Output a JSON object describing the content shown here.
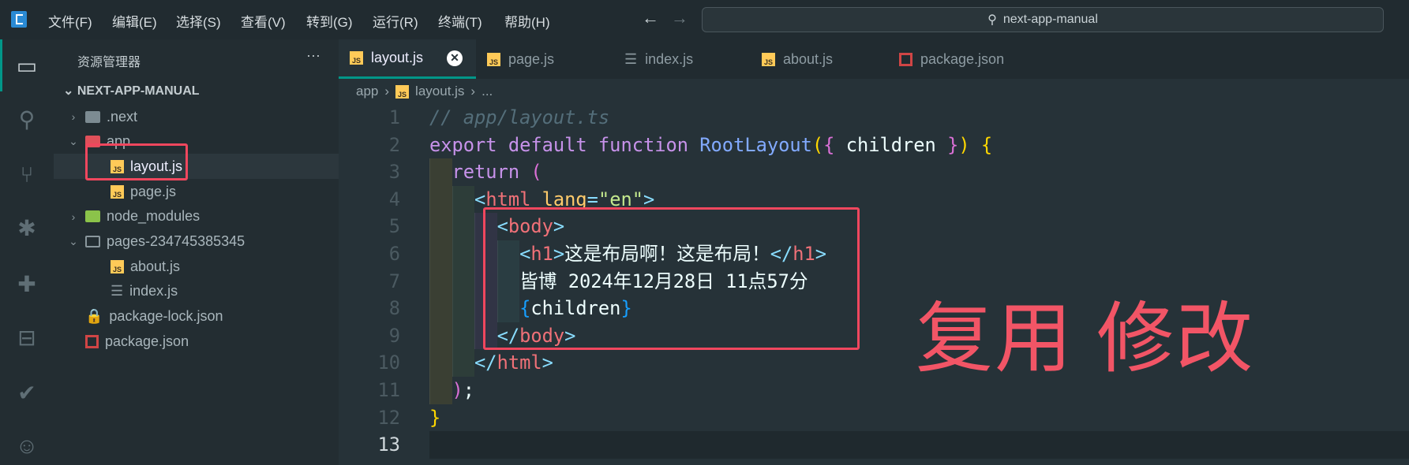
{
  "menu": [
    "文件(F)",
    "编辑(E)",
    "选择(S)",
    "查看(V)",
    "转到(G)",
    "运行(R)",
    "终端(T)",
    "帮助(H)"
  ],
  "search": {
    "text": "next-app-manual"
  },
  "sidebar": {
    "title": "资源管理器",
    "more": "···",
    "root": "NEXT-APP-MANUAL",
    "items": [
      {
        "label": ".next",
        "level": 0,
        "type": "folder-next",
        "chevron": "›"
      },
      {
        "label": "app",
        "level": 0,
        "type": "folder-app",
        "chevron": "⌄"
      },
      {
        "label": "layout.js",
        "level": 1,
        "type": "js",
        "selected": true
      },
      {
        "label": "page.js",
        "level": 1,
        "type": "js"
      },
      {
        "label": "node_modules",
        "level": 0,
        "type": "folder-node",
        "chevron": "›"
      },
      {
        "label": "pages-234745385345",
        "level": 0,
        "type": "folder",
        "chevron": "⌄"
      },
      {
        "label": "about.js",
        "level": 1,
        "type": "js"
      },
      {
        "label": "index.js",
        "level": 1,
        "type": "list"
      },
      {
        "label": "package-lock.json",
        "level": 0,
        "type": "lock"
      },
      {
        "label": "package.json",
        "level": 0,
        "type": "npm"
      }
    ]
  },
  "tabs": [
    {
      "label": "layout.js",
      "type": "js",
      "active": true
    },
    {
      "label": "page.js",
      "type": "js"
    },
    {
      "label": "index.js",
      "type": "list"
    },
    {
      "label": "about.js",
      "type": "js"
    },
    {
      "label": "package.json",
      "type": "npm"
    }
  ],
  "breadcrumb": [
    "app",
    "layout.js",
    "..."
  ],
  "code": [
    [
      [
        "// app/layout.ts",
        "comment"
      ]
    ],
    [
      [
        "export ",
        "kw"
      ],
      [
        "default ",
        "kw"
      ],
      [
        "function ",
        "kw"
      ],
      [
        "RootLayout",
        "fn"
      ],
      [
        "(",
        "by"
      ],
      [
        "{ ",
        "bp"
      ],
      [
        "children ",
        "txt"
      ],
      [
        "}",
        "bp"
      ],
      [
        ")",
        "by"
      ],
      [
        " {",
        "by"
      ]
    ],
    [
      [
        "  return ",
        "kw"
      ],
      [
        "(",
        "bp"
      ]
    ],
    [
      [
        "    <",
        "pu"
      ],
      [
        "html ",
        "tag"
      ],
      [
        "lang",
        "attr"
      ],
      [
        "=",
        "pu"
      ],
      [
        "\"en\"",
        "str"
      ],
      [
        ">",
        "pu"
      ]
    ],
    [
      [
        "      <",
        "pu"
      ],
      [
        "body",
        "tag"
      ],
      [
        ">",
        "pu"
      ]
    ],
    [
      [
        "        <",
        "pu"
      ],
      [
        "h1",
        "tag"
      ],
      [
        ">",
        "pu"
      ],
      [
        "这是布局啊！这是布局！",
        "txt"
      ],
      [
        "</",
        "pu"
      ],
      [
        "h1",
        "tag"
      ],
      [
        ">",
        "pu"
      ]
    ],
    [
      [
        "        皆博 2024年12月28日 11点57分",
        "txt"
      ]
    ],
    [
      [
        "        {",
        "bb"
      ],
      [
        "children",
        "txt"
      ],
      [
        "}",
        "bb"
      ]
    ],
    [
      [
        "      </",
        "pu"
      ],
      [
        "body",
        "tag"
      ],
      [
        ">",
        "pu"
      ]
    ],
    [
      [
        "    </",
        "pu"
      ],
      [
        "html",
        "tag"
      ],
      [
        ">",
        "pu"
      ]
    ],
    [
      [
        "  )",
        "bp"
      ],
      [
        ";",
        "txt"
      ]
    ],
    [
      [
        "}",
        "by"
      ]
    ],
    [
      [
        "",
        ""
      ]
    ]
  ],
  "annotation": "复用 修改"
}
